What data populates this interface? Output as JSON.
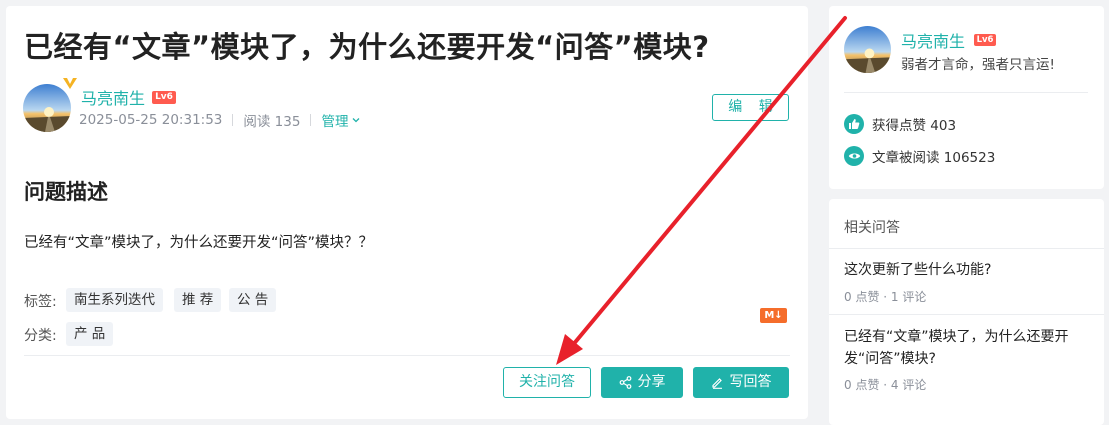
{
  "question": {
    "title": "已经有“文章”模块了，为什么还要开发“问答”模块?",
    "section_title": "问题描述",
    "body": "已经有“文章”模块了，为什么还要开发“问答”模块？？"
  },
  "author": {
    "name": "马亮南生",
    "level": "Lv6",
    "date": "2025-05-25 20:31:53",
    "reads": "阅读 135",
    "manage": "管理"
  },
  "actions": {
    "edit": "编 辑",
    "follow": "关注问答",
    "share": "分享",
    "answer": "写回答"
  },
  "tags": {
    "label": "标签:",
    "items": [
      "南生系列迭代",
      "推 荐",
      "公 告"
    ]
  },
  "category": {
    "label": "分类:",
    "items": [
      "产 品"
    ]
  },
  "md_badge": "M↓",
  "sidebar": {
    "profile": {
      "name": "马亮南生",
      "level": "Lv6",
      "motto": "弱者才言命，强者只言运!",
      "likes": "获得点赞 403",
      "reads": "文章被阅读 106523"
    },
    "related": {
      "title": "相关问答",
      "items": [
        {
          "question": "这次更新了些什么功能?",
          "meta": "0 点赞 · 1 评论"
        },
        {
          "question": "已经有“文章”模块了，为什么还要开发“问答”模块?",
          "meta": "0 点赞 · 4 评论"
        }
      ]
    }
  },
  "colors": {
    "accent": "#20b2aa",
    "level_badge": "#ff5b4f",
    "annotation_arrow": "#e8212b",
    "md_badge": "#f56d2b",
    "vip_badge": "#f5b323"
  },
  "icons": [
    "avatar-sunset-image",
    "vip-crown-icon",
    "chevron-down-icon",
    "share-icon",
    "pencil-icon",
    "thumb-up-icon",
    "eye-icon"
  ]
}
